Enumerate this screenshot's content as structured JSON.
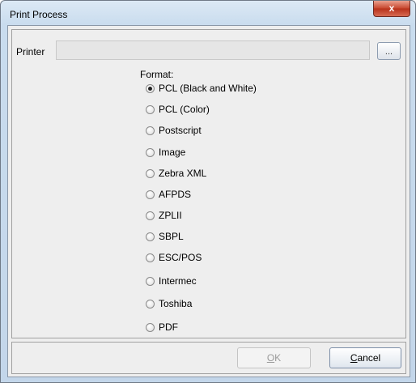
{
  "window": {
    "title": "Print Process",
    "close_label": "x"
  },
  "printer": {
    "label": "Printer",
    "value": "",
    "browse_label": "..."
  },
  "format": {
    "label": "Format:",
    "options": [
      {
        "label": "PCL (Black and White)",
        "selected": true
      },
      {
        "label": "PCL (Color)",
        "selected": false
      },
      {
        "label": "Postscript",
        "selected": false
      },
      {
        "label": "Image",
        "selected": false
      },
      {
        "label": "Zebra XML",
        "selected": false
      },
      {
        "label": "AFPDS",
        "selected": false
      },
      {
        "label": "ZPLII",
        "selected": false
      },
      {
        "label": "SBPL",
        "selected": false
      },
      {
        "label": "ESC/POS",
        "selected": false
      },
      {
        "label": "Intermec",
        "selected": false
      },
      {
        "label": "Toshiba",
        "selected": false
      },
      {
        "label": "PDF",
        "selected": false
      }
    ]
  },
  "buttons": {
    "ok_mnemonic": "O",
    "ok_rest": "K",
    "ok_enabled": false,
    "cancel_mnemonic": "C",
    "cancel_rest": "ancel"
  }
}
